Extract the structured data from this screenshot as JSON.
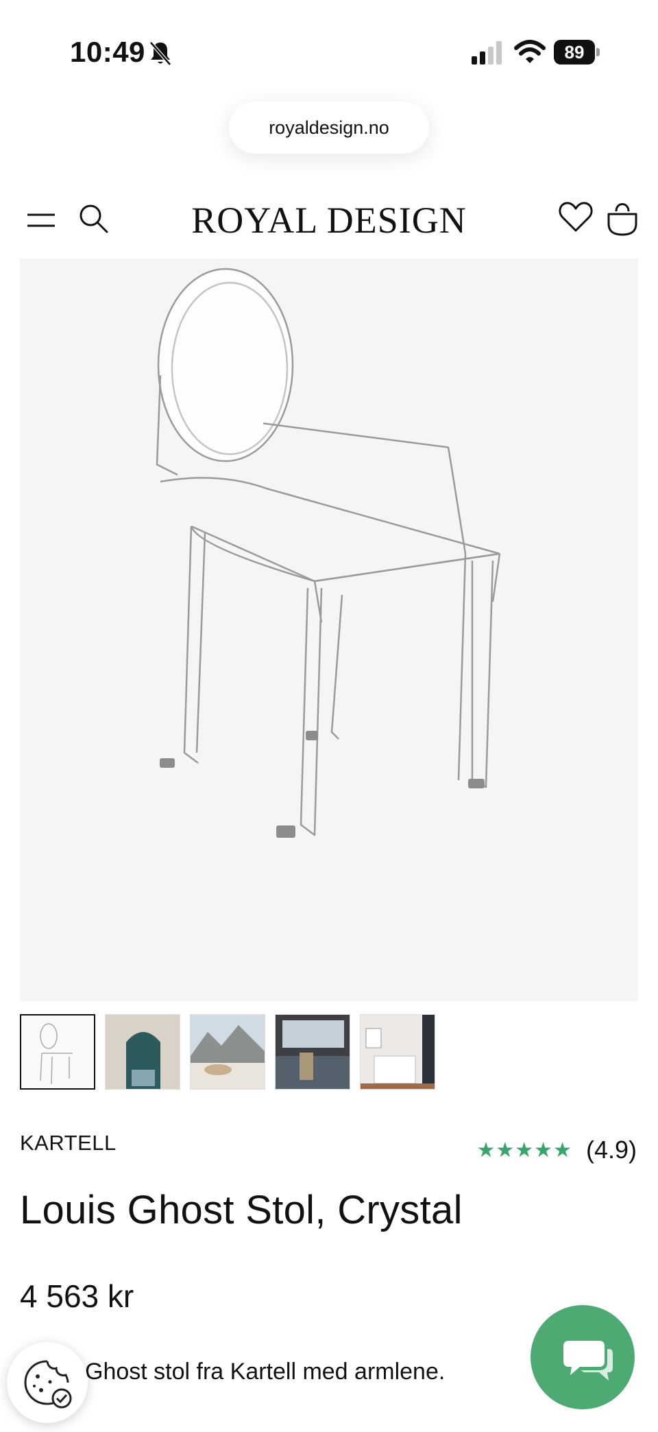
{
  "status_bar": {
    "time": "10:49",
    "battery": "89"
  },
  "browser": {
    "url": "royaldesign.no"
  },
  "header": {
    "logo": "ROYAL DESIGN"
  },
  "product": {
    "brand": "KARTELL",
    "stars": "★★★★★",
    "rating": "(4.9)",
    "title": "Louis Ghost Stol, Crystal",
    "price": "4 563 kr",
    "description": "Ghost stol fra Kartell med armlene.",
    "thumbnail_count": 5
  },
  "colors": {
    "accent_green": "#4eaa73",
    "star_green": "#3aa56a",
    "image_bg": "#f5f5f5"
  }
}
